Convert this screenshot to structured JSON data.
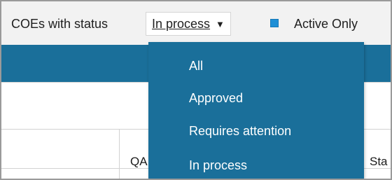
{
  "filter": {
    "label": "COEs with status",
    "selected": "In process",
    "arrow_icon": "triangle-down-icon"
  },
  "active_only": {
    "label": "Active Only",
    "checked": true
  },
  "table": {
    "columns": [
      "QA",
      "Sta"
    ]
  },
  "dropdown": {
    "options": [
      "All",
      "Approved",
      "Requires attention",
      "In process"
    ]
  },
  "colors": {
    "accent": "#1a6f9a",
    "checkbox": "#1f8fd6"
  }
}
